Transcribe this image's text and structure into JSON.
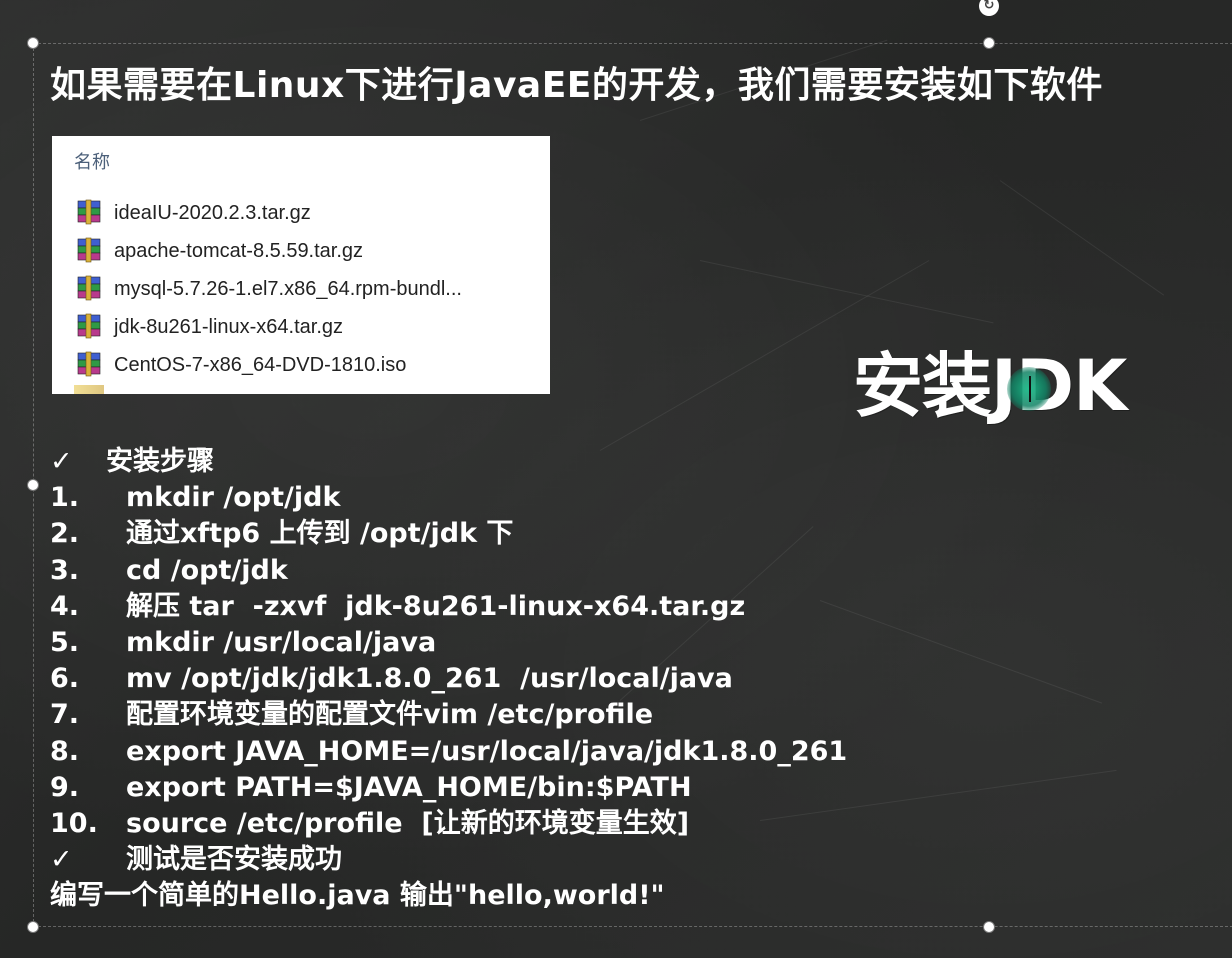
{
  "slide": {
    "title": "如果需要在Linux下进行JavaEE的开发，我们需要安装如下软件",
    "big_title": "安装JDK",
    "rotate_glyph": "↻"
  },
  "file_panel": {
    "header": "名称",
    "files": [
      {
        "name": "ideaIU-2020.2.3.tar.gz",
        "icon": "winrar-archive-icon"
      },
      {
        "name": "apache-tomcat-8.5.59.tar.gz",
        "icon": "winrar-archive-icon"
      },
      {
        "name": "mysql-5.7.26-1.el7.x86_64.rpm-bundl...",
        "icon": "winrar-archive-icon"
      },
      {
        "name": "jdk-8u261-linux-x64.tar.gz",
        "icon": "winrar-archive-icon"
      },
      {
        "name": "CentOS-7-x86_64-DVD-1810.iso",
        "icon": "winrar-archive-icon"
      }
    ]
  },
  "steps_section": {
    "check_glyph": "✓",
    "heading": "安装步骤",
    "steps": [
      {
        "number": "1.",
        "text": "mkdir /opt/jdk"
      },
      {
        "number": "2.",
        "text": "通过xftp6 上传到 /opt/jdk 下"
      },
      {
        "number": "3.",
        "text": "cd /opt/jdk"
      },
      {
        "number": "4.",
        "text": "解压 tar  -zxvf  jdk-8u261-linux-x64.tar.gz"
      },
      {
        "number": "5.",
        "text": "mkdir /usr/local/java"
      },
      {
        "number": "6.",
        "text": "mv /opt/jdk/jdk1.8.0_261  /usr/local/java"
      },
      {
        "number": "7.",
        "text": "配置环境变量的配置文件vim /etc/profile"
      },
      {
        "number": "8.",
        "text": "export JAVA_HOME=/usr/local/java/jdk1.8.0_261"
      },
      {
        "number": "9.",
        "text": "export PATH=$JAVA_HOME/bin:$PATH"
      },
      {
        "number": "10.",
        "text": "source /etc/profile  [让新的环境变量生效]"
      }
    ],
    "test_heading": "测试是否安装成功",
    "final_line": "编写一个简单的Hello.java 输出\"hello,world!\""
  },
  "colors": {
    "background": "#2a2b2a",
    "text": "#ffffff",
    "panel_background": "#ffffff",
    "panel_header": "#4c607a",
    "cursor_highlight": "#1aba88"
  }
}
